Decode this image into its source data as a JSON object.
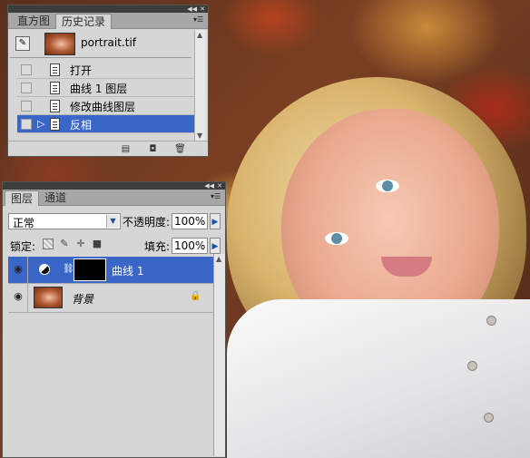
{
  "history_panel": {
    "tabs": [
      "直方图",
      "历史记录"
    ],
    "active_tab": 1,
    "snapshot_label": "portrait.tif",
    "steps": [
      {
        "label": "打开",
        "selected": false
      },
      {
        "label": "曲线 1 图层",
        "selected": false
      },
      {
        "label": "修改曲线图层",
        "selected": false
      },
      {
        "label": "反相",
        "selected": true
      }
    ],
    "footer_icons": [
      "new-document-icon",
      "camera-icon",
      "trash-icon"
    ]
  },
  "layers_panel": {
    "tabs": [
      "图层",
      "通道"
    ],
    "active_tab": 0,
    "blend_mode": "正常",
    "opacity_label": "不透明度:",
    "opacity_value": "100%",
    "lock_label": "锁定:",
    "fill_label": "填充:",
    "fill_value": "100%",
    "layers": [
      {
        "name": "曲线 1",
        "visible": true,
        "selected": true,
        "type": "adjustment"
      },
      {
        "name": "背景",
        "visible": true,
        "selected": false,
        "type": "background",
        "locked": true
      }
    ]
  },
  "colors": {
    "selection": "#3a66c8",
    "panel_bg": "#d6d6d6",
    "tab_bar": "#a7a7a7"
  }
}
